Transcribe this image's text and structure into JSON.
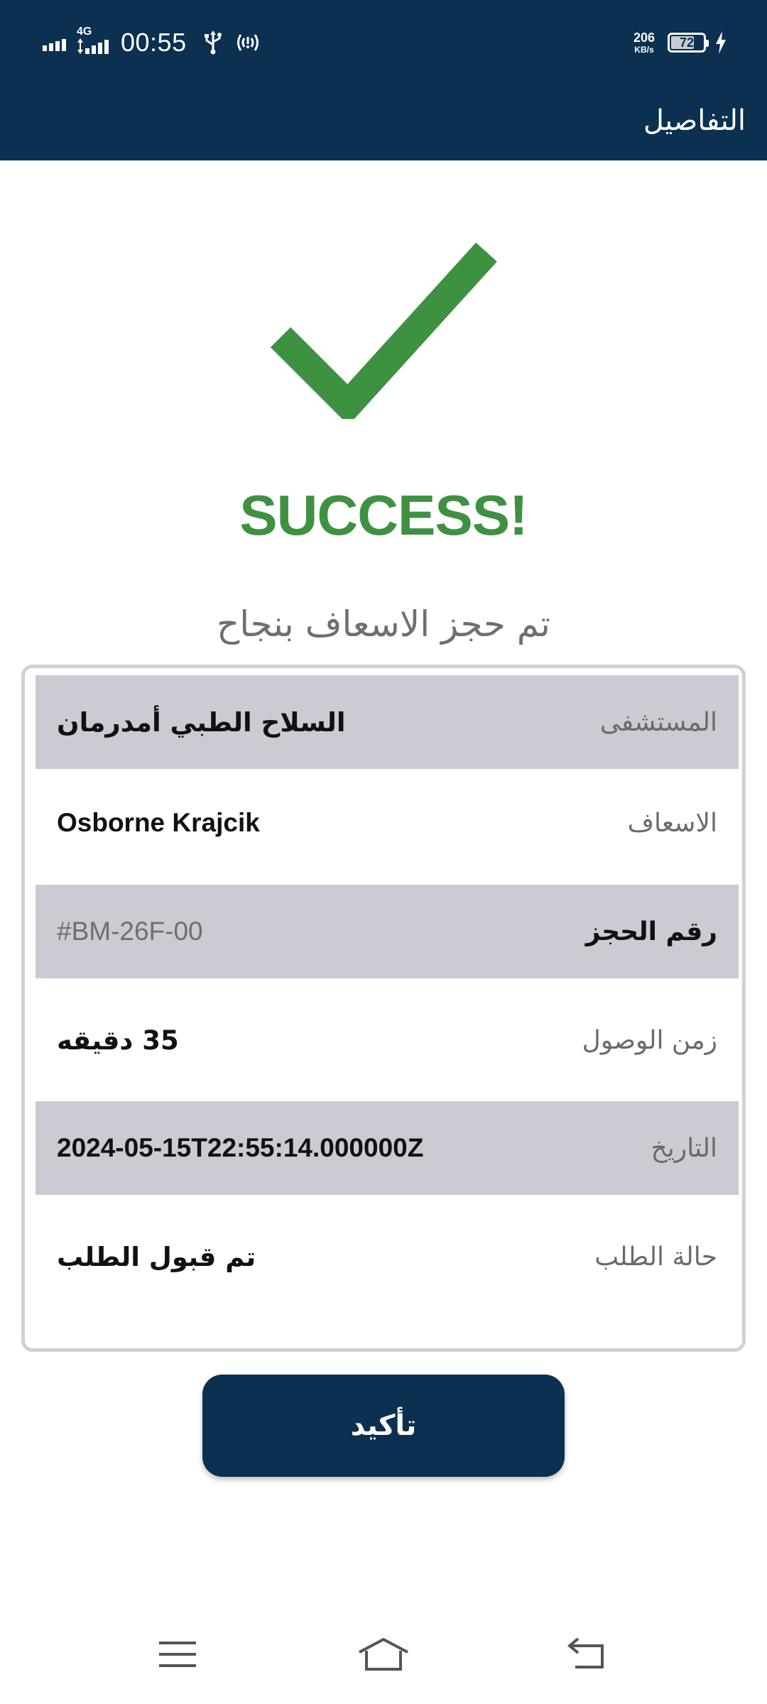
{
  "status_bar": {
    "network": "4G",
    "time": "00:55",
    "net_speed_value": "206",
    "net_speed_unit": "KB/s",
    "battery_level": "72",
    "battery_fraction": 0.72,
    "icons": [
      "signal-icon",
      "signal-4g-icon",
      "usb-icon",
      "hotspot-icon",
      "battery-icon",
      "charging-icon"
    ]
  },
  "header": {
    "title": "التفاصيل"
  },
  "main": {
    "success_title": "SUCCESS!",
    "success_message": "تم حجز الاسعاف بنجاح",
    "icon": "checkmark-icon"
  },
  "details": [
    {
      "label": "المستشفى",
      "value": "السلاح الطبي أمدرمان"
    },
    {
      "label": "الاسعاف",
      "value": "Osborne Krajcik"
    },
    {
      "label": "رقم الحجز",
      "value": "#BM-26F-00"
    },
    {
      "label": "زمن الوصول",
      "value": "35 دقيقه"
    },
    {
      "label": "التاريخ",
      "value": "2024-05-15T22:55:14.000000Z"
    },
    {
      "label": "حالة الطلب",
      "value": "تم قبول الطلب"
    }
  ],
  "actions": {
    "confirm_label": "تأكيد"
  },
  "navigation": {
    "icons": [
      "menu-icon",
      "home-icon",
      "back-icon"
    ]
  },
  "colors": {
    "primary": "#0b3050",
    "success": "#3f9142",
    "row_shade": "#cbcbd4"
  }
}
